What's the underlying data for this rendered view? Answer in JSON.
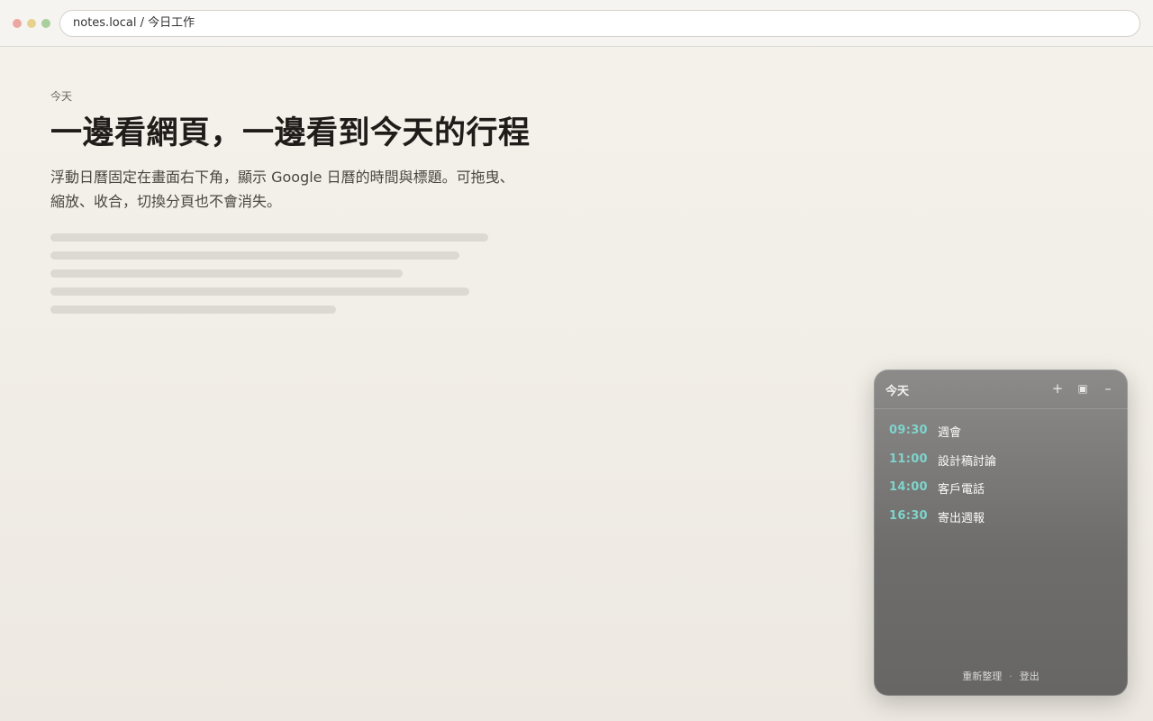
{
  "browser": {
    "address": "notes.local / 今日工作"
  },
  "page": {
    "eyebrow": "今天",
    "title": "一邊看網頁，一邊看到今天的行程",
    "description": "浮動日曆固定在畫面右下角，顯示 Google 日曆的時間與標題。可拖曳、縮放、收合，切換分頁也不會消失。"
  },
  "widget": {
    "title": "今天",
    "add_icon": "+",
    "square_icon": "▣",
    "minimize_icon": "–",
    "events": [
      {
        "time": "09:30",
        "title": "週會"
      },
      {
        "time": "11:00",
        "title": "設計稿討論"
      },
      {
        "time": "14:00",
        "title": "客戶電話"
      },
      {
        "time": "16:30",
        "title": "寄出週報"
      }
    ],
    "footer": {
      "refresh": "重新整理",
      "separator": "·",
      "logout": "登出"
    }
  },
  "colors": {
    "accent_time": "#7fd3cc",
    "widget_bg": "#6e6d6b",
    "page_bg": "#f5f2ec"
  }
}
